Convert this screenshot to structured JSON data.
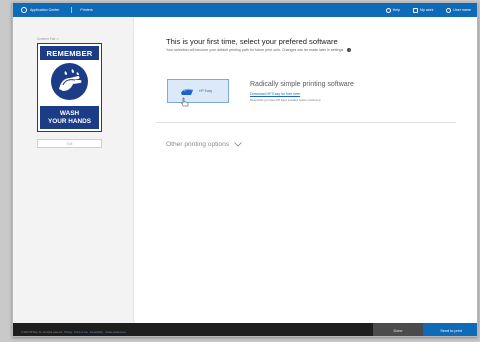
{
  "topbar": {
    "app_title": "Application Center",
    "section": "Printers",
    "help": "Help",
    "my_work": "My work",
    "user": "User name"
  },
  "sidebar": {
    "label": "Summer Fair  ↺",
    "poster": {
      "top_text": "REMEMBER",
      "bottom_line1": "WASH",
      "bottom_line2": "YOUR HANDS",
      "colors": {
        "navy": "#1c3c87",
        "white": "#ffffff"
      }
    },
    "button": "Edit"
  },
  "main": {
    "title": "This is your first time, select your prefered software",
    "subtitle": "Your selection will become your default printing path for future print outs. Changes can be made later in settings",
    "option_card": {
      "label": "HP Easy"
    },
    "promo": {
      "title": "Radically simple printing software",
      "link": "Download HP Easy for free here",
      "note": "Meanwhile you have HP Easy installed before continuing"
    },
    "other_options": "Other printing options"
  },
  "bottombar": {
    "status_text": "© 2021 HP Dev. Co. All rights reserved · ",
    "status_link": "Privacy · Terms of use · Accessibility · Cookie preferences",
    "done": "Done",
    "send": "Send to print"
  },
  "colors": {
    "brand_blue": "#0f6ab7",
    "card_bg": "#dce9f8",
    "dark_bar": "#1e1e1e"
  }
}
